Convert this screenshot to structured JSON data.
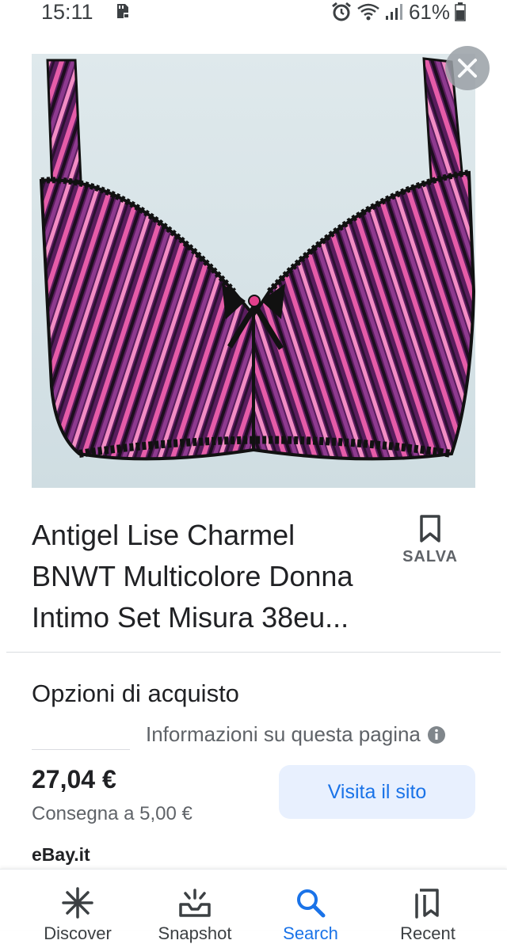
{
  "status_bar": {
    "time": "15:11",
    "battery": "61%"
  },
  "product": {
    "title_lines": [
      "Antigel Lise Charmel",
      "BNWT Multicolore Donna",
      "Intimo Set Misura 38eu..."
    ],
    "save_label": "SALVA"
  },
  "purchase": {
    "section_title": "Opzioni di acquisto",
    "info_text": "Informazioni su questa pagina",
    "price": "27,04 €",
    "shipping": "Consegna a 5,00 €",
    "visit_label": "Visita il sito",
    "seller": "eBay.it"
  },
  "bottom_nav": {
    "items": [
      {
        "label": "Discover",
        "icon": "asterisk-icon"
      },
      {
        "label": "Snapshot",
        "icon": "tray-sparkle-icon"
      },
      {
        "label": "Search",
        "icon": "search-icon"
      },
      {
        "label": "Recent",
        "icon": "collections-icon"
      }
    ],
    "active": "Search"
  },
  "colors": {
    "accent": "#1a73e8",
    "button_bg": "#e8f0fe",
    "text": "#202124",
    "muted": "#5f6368"
  }
}
